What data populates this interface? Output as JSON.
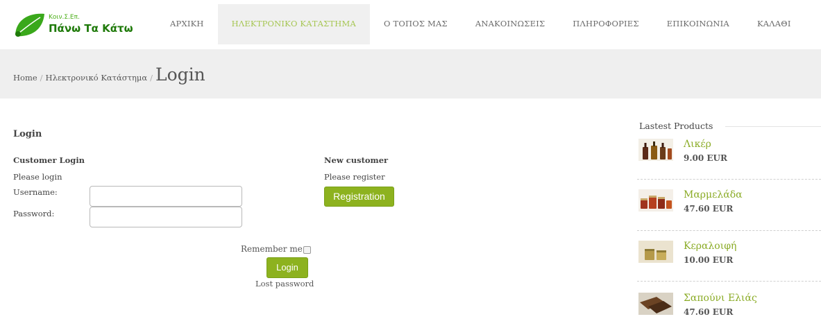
{
  "logo": {
    "small_text": "Κοιν.Σ.Επ.",
    "name": "Πάνω Τα Κάτω"
  },
  "nav": {
    "items": [
      {
        "label": "ΑΡΧΙΚΗ"
      },
      {
        "label": "ΗΛΕΚΤΡΟΝΙΚΟ ΚΑΤΑΣΤΗΜΑ"
      },
      {
        "label": "Ο ΤΟΠΟΣ ΜΑΣ"
      },
      {
        "label": "ΑΝΑΚΟΙΝΩΣΕΙΣ"
      },
      {
        "label": "ΠΛΗΡΟΦΟΡΙΕΣ"
      },
      {
        "label": "ΕΠΙΚΟΙΝΩΝΙΑ"
      },
      {
        "label": "ΚΑΛΑΘΙ"
      }
    ],
    "active_color": "#a6c652"
  },
  "breadcrumb": {
    "home": "Home",
    "shop": "Ηλεκτρονικό Κατάστημα",
    "separator": "/",
    "current": "Login"
  },
  "login": {
    "heading": "Login",
    "customer_title": "Customer Login",
    "customer_sub": "Please login",
    "username_label": "Username:",
    "username_value": "",
    "password_label": "Password:",
    "password_value": "",
    "remember_label": "Remember me",
    "remember_checked": false,
    "submit_label": "Login",
    "lost_password": "Lost password"
  },
  "register": {
    "title": "New customer",
    "sub": "Please register",
    "button_label": "Registration"
  },
  "sidebar": {
    "heading": "Lastest Products",
    "products": [
      {
        "name": "Λικέρ",
        "price": "9.00 EUR",
        "icon": "liqueur-bottles-icon"
      },
      {
        "name": "Μαρμελάδα",
        "price": "47.60 EUR",
        "icon": "jam-jars-icon"
      },
      {
        "name": "Κεραλοιφή",
        "price": "10.00 EUR",
        "icon": "wax-ointment-jars-icon"
      },
      {
        "name": "Σαπούνι Ελιάς",
        "price": "47.60 EUR",
        "icon": "olive-soap-bars-icon"
      }
    ]
  },
  "colors": {
    "brand_green": "#8db21f",
    "link_green": "#8aab25",
    "band_grey": "#efefef"
  }
}
